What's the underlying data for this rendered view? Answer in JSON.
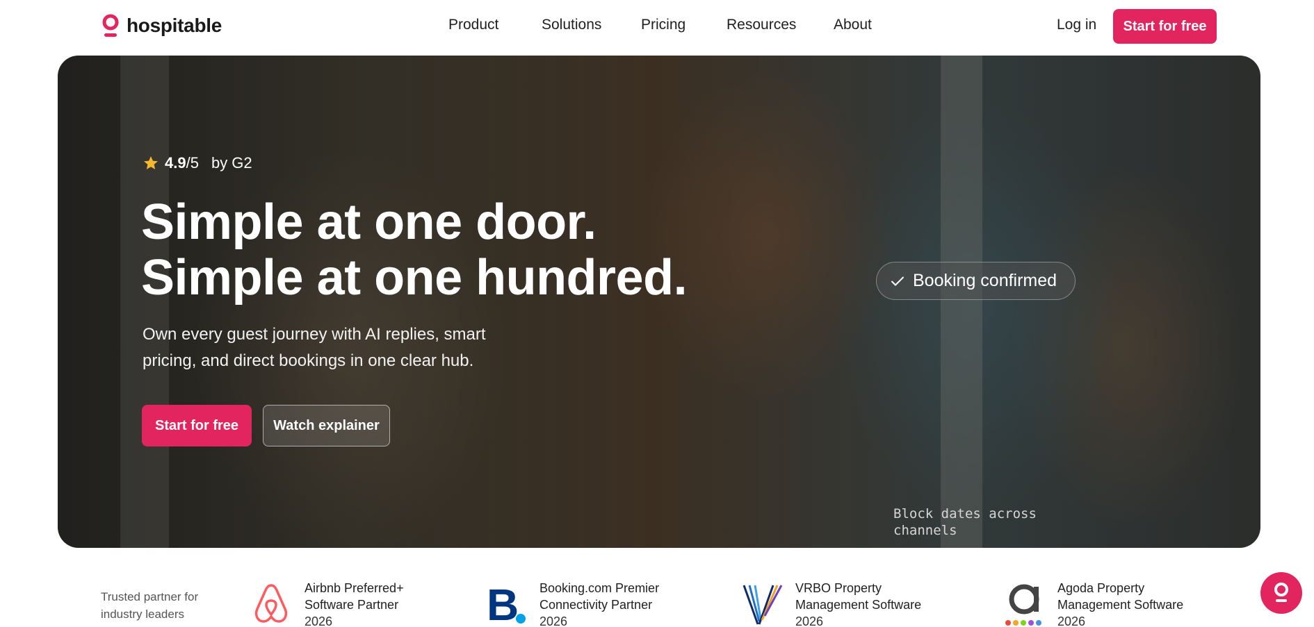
{
  "brand": {
    "name": "hospitable",
    "accent": "#e2245f"
  },
  "nav": {
    "items": [
      {
        "label": "Product"
      },
      {
        "label": "Solutions"
      },
      {
        "label": "Pricing"
      },
      {
        "label": "Resources"
      },
      {
        "label": "About"
      }
    ],
    "login_label": "Log in",
    "cta_label": "Start for free"
  },
  "hero": {
    "rating": {
      "score": "4.9",
      "out_of": "/5",
      "source": "by G2",
      "icon": "star-icon"
    },
    "headline_line1": "Simple at one door.",
    "headline_line2": "Simple at one hundred.",
    "subtext": "Own every guest journey with AI replies, smart pricing, and direct bookings in one clear hub.",
    "primary_button": "Start for free",
    "secondary_button": "Watch explainer",
    "booking_badge": "Booking confirmed",
    "caption": "Block dates across channels"
  },
  "partners": {
    "intro": "Trusted partner for industry leaders",
    "items": [
      {
        "title_line1": "Airbnb Preferred+",
        "title_line2": "Software Partner",
        "year": "2026",
        "icon": "airbnb-logo"
      },
      {
        "title_line1": "Booking.com Premier",
        "title_line2": "Connectivity Partner",
        "year": "2026",
        "icon": "booking-logo"
      },
      {
        "title_line1": "VRBO Property",
        "title_line2": "Management Software",
        "year": "2026",
        "icon": "vrbo-logo"
      },
      {
        "title_line1": "Agoda Property",
        "title_line2": "Management Software",
        "year": "2026",
        "icon": "agoda-logo"
      }
    ]
  },
  "chat": {
    "icon": "chat-launcher-icon"
  }
}
